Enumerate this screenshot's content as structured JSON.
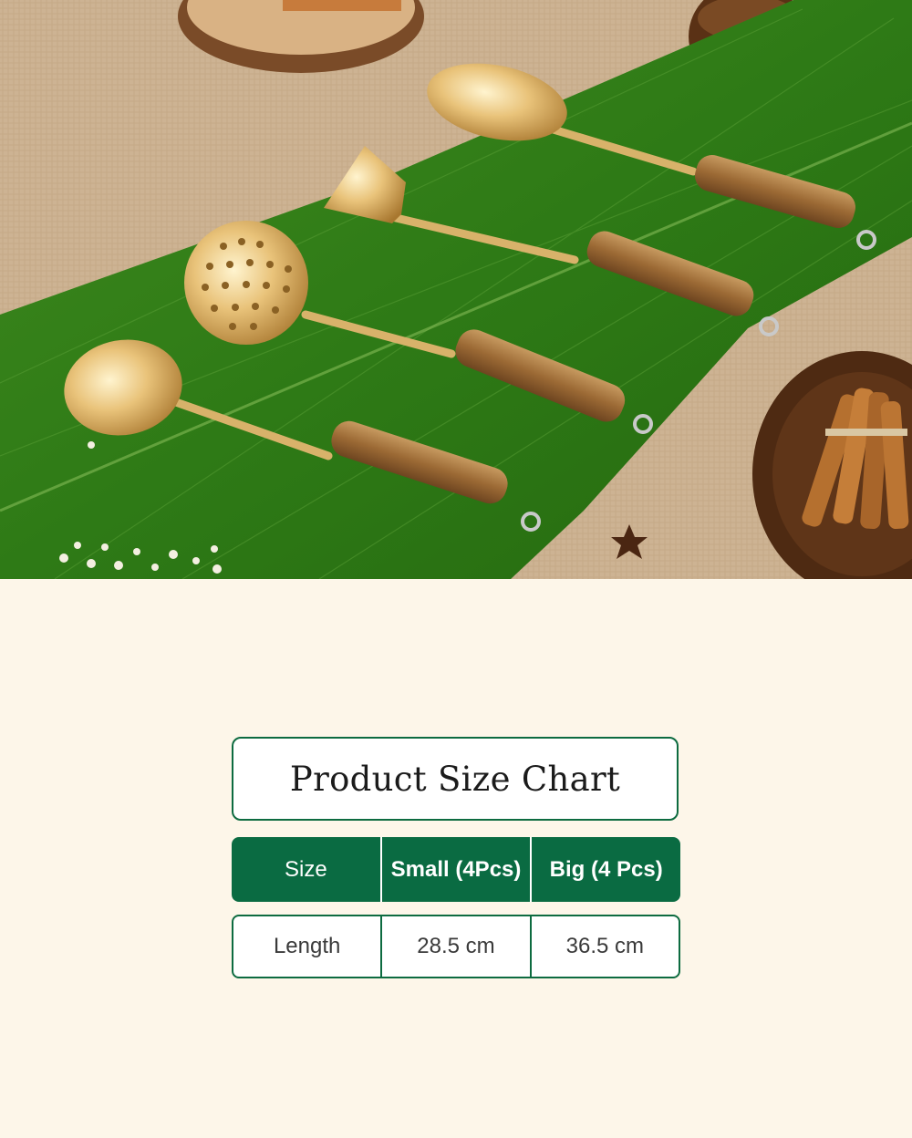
{
  "size_chart": {
    "title": "Product Size Chart",
    "headers": [
      "Size",
      "Small (4Pcs)",
      "Big (4 Pcs)"
    ],
    "rows": [
      [
        "Length",
        "28.5 cm",
        "36.5 cm"
      ]
    ]
  },
  "colors": {
    "background": "#fdf6e9",
    "accent_green": "#0a6b42",
    "border_green": "#0d6b40"
  }
}
